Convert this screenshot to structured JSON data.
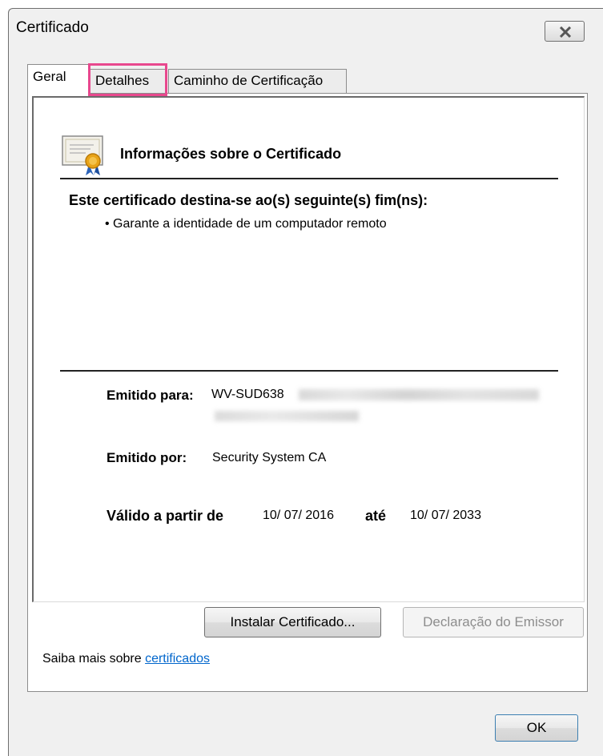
{
  "window": {
    "title": "Certificado"
  },
  "tabs": [
    {
      "label": "Geral",
      "active": true
    },
    {
      "label": "Detalhes",
      "active": false,
      "highlighted": true
    },
    {
      "label": "Caminho de Certificação",
      "active": false
    }
  ],
  "general": {
    "heading": "Informações sobre o Certificado",
    "purpose_heading": "Este certificado destina-se ao(s) seguinte(s) fim(ns):",
    "purposes": [
      "• Garante a identidade de um computador remoto"
    ],
    "issued_to_label": "Emitido para:",
    "issued_to_value": "WV-SUD638",
    "issued_by_label": "Emitido por:",
    "issued_by_value": "Security System CA",
    "valid_from_label": "Válido a partir de",
    "valid_from_value": "10/ 07/ 2016",
    "valid_to_label": "até",
    "valid_to_value": "10/ 07/ 2033"
  },
  "buttons": {
    "install": "Instalar Certificado...",
    "issuer_statement": "Declaração do Emissor",
    "ok": "OK"
  },
  "learn_more": {
    "prefix": "Saiba mais sobre ",
    "link": "certificados"
  },
  "colors": {
    "highlight": "#e8488e",
    "link": "#0066cc"
  }
}
